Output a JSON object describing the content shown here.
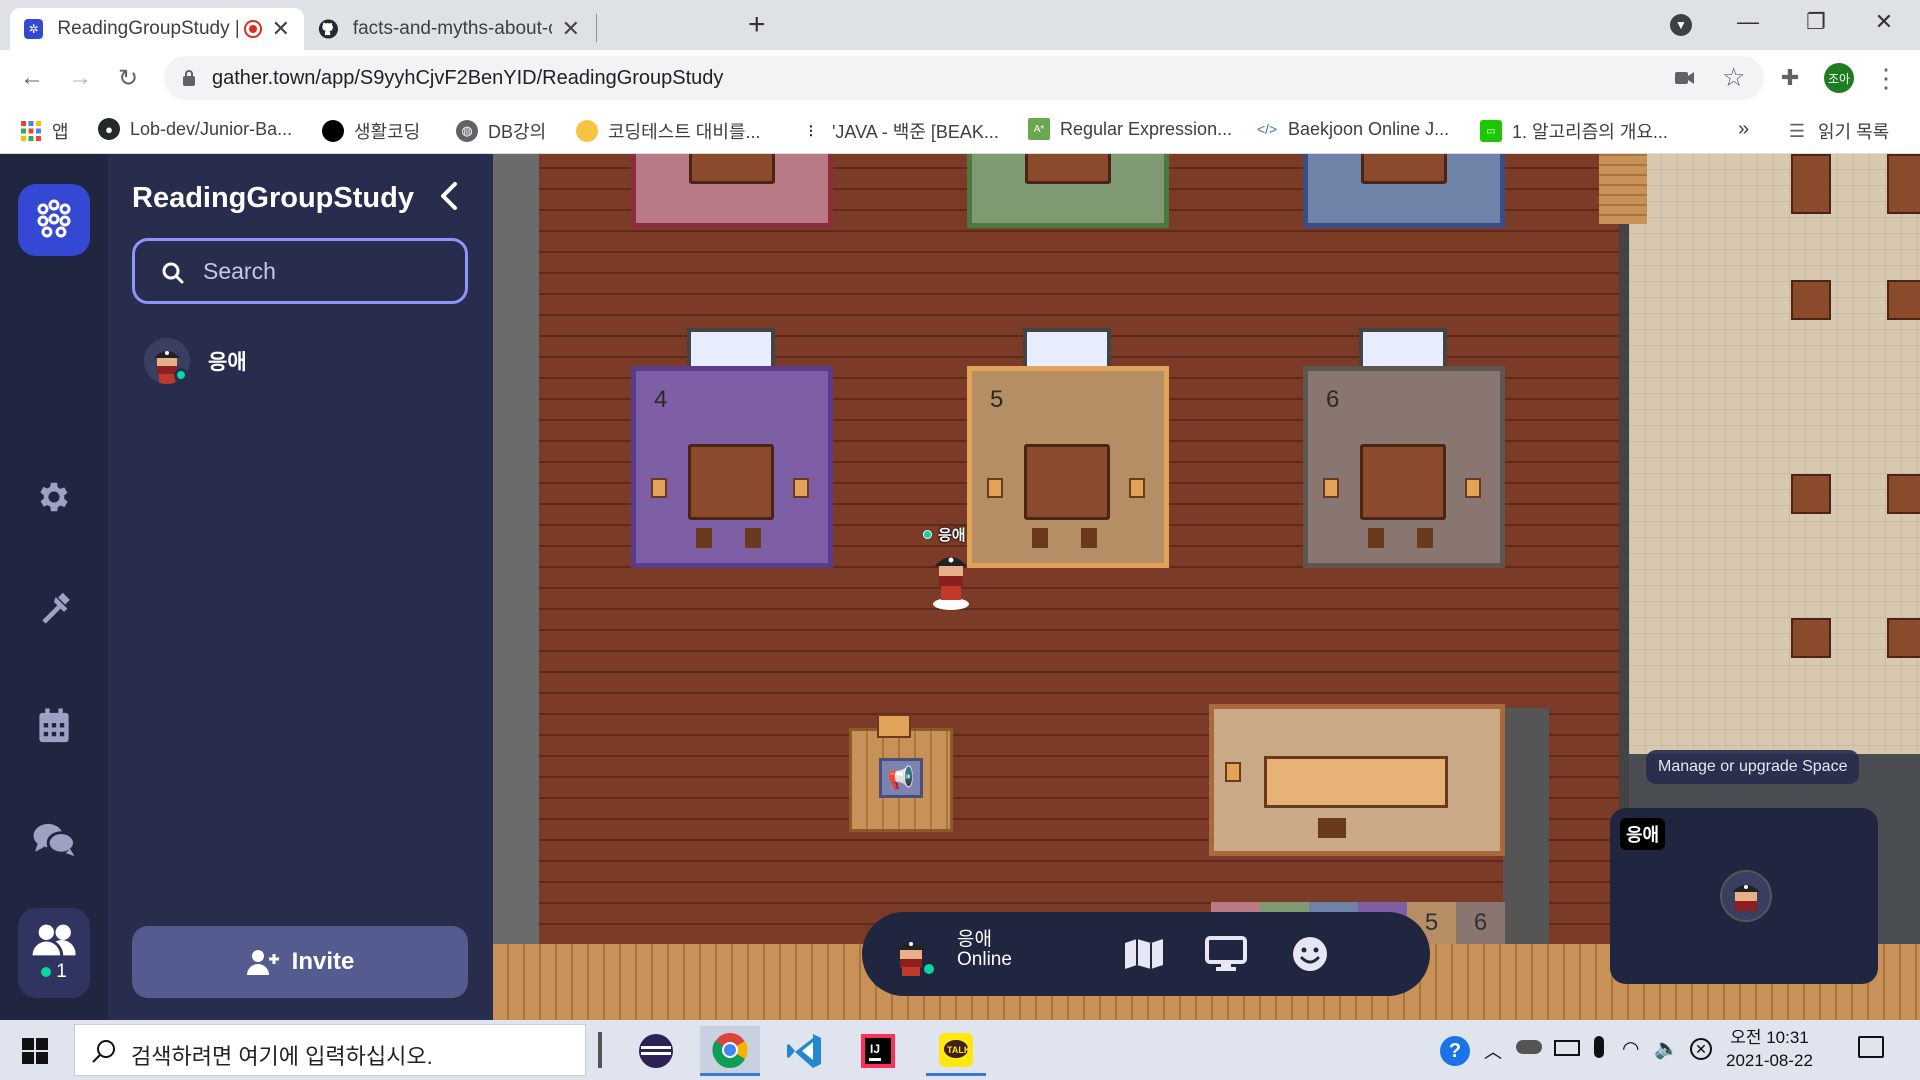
{
  "browser": {
    "tabs": [
      {
        "title": "ReadingGroupStudy | Gather",
        "close": "✕"
      },
      {
        "title": "facts-and-myths-about-oo/week",
        "close": "✕"
      }
    ],
    "new_tab": "+",
    "url": "gather.town/app/S9yyhCjvF2BenYID/ReadingGroupStudy",
    "profile": "조아",
    "bookmarks": [
      {
        "label": "앱",
        "icon": "apps-grid-icon"
      },
      {
        "label": "Lob-dev/Junior-Ba...",
        "icon": "github-icon"
      },
      {
        "label": "생활코딩",
        "icon": "black-circle-icon"
      },
      {
        "label": "DB강의",
        "icon": "globe-icon"
      },
      {
        "label": "코딩테스트 대비를...",
        "icon": "yellow-circle-icon"
      },
      {
        "label": "'JAVA - 백준 [BEAK...",
        "icon": "dots-icon"
      },
      {
        "label": "Regular Expression...",
        "icon": "regex-icon"
      },
      {
        "label": "Baekjoon Online J...",
        "icon": "code-icon"
      },
      {
        "label": "1. 알고리즘의 개요...",
        "icon": "green-square-icon"
      }
    ],
    "bookmarks_more": "»",
    "reading_list": "읽기 목록"
  },
  "sidebar": {
    "space_title": "ReadingGroupStudy",
    "search_placeholder": "Search",
    "members": [
      {
        "name": "응애",
        "status": "online"
      }
    ],
    "invite_label": "Invite",
    "participant_count": "1"
  },
  "map": {
    "room_numbers": [
      "4",
      "5",
      "6"
    ],
    "player_label": "응애",
    "legend_numbers": [
      "5",
      "6"
    ],
    "manage_tooltip": "Manage or upgrade Space",
    "video_tile_name": "응애"
  },
  "bottom_bar": {
    "name": "응애",
    "status": "Online"
  },
  "taskbar": {
    "search_placeholder": "검색하려면 여기에 입력하십시오.",
    "time": "오전 10:31",
    "date": "2021-08-22"
  },
  "colors": {
    "gather_blue": "#3448d3",
    "sidebar_bg": "#282d4e",
    "rail_bg": "#202540",
    "online_green": "#06d6a0",
    "search_border": "#8f94ff"
  }
}
